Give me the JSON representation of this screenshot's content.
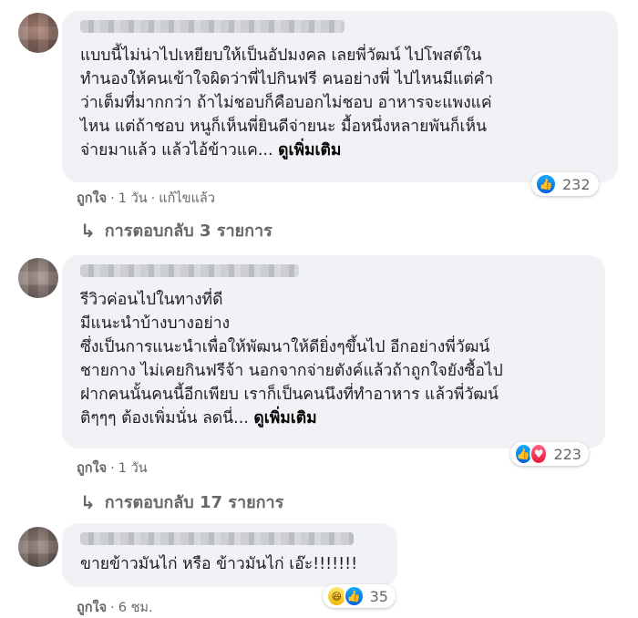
{
  "comments": [
    {
      "text": "แบบนี้ไม่น่าไปเหยียบให้เป็นอัปมงคล เลยพี่วัฒน์ ไปโพสต์ใน\nทำนองให้คนเข้าใจผิดว่าพี่ไปกินฟรี คนอย่างพี่ ไปไหนมีแต่คำ\nว่าเต็มที่มากกว่า ถ้าไม่ชอบก็คือบอกไม่ชอบ อาหารจะแพงแค่\nไหน แต่ถ้าชอบ หนูก็เห็นพี่ยินดีจ่ายนะ มื้อหนึ่งหลายพันก็เห็น\nจ่ายมาแล้ว แล้วไอ้ข้าวแค... ",
      "see_more": "ดูเพิ่มเติม",
      "reaction_count": "232",
      "reactions": [
        "like-icon"
      ],
      "like_label": "ถูกใจ",
      "time": "1 วัน",
      "edited": "แก้ไขแล้ว",
      "replies_label": "การตอบกลับ 3 รายการ"
    },
    {
      "text": "รีวิวค่อนไปในทางที่ดี\nมีแนะนำบ้างบางอย่าง\nซึ่งเป็นการแนะนำเพื่อให้พัฒนาให้ดียิ่งๆขึ้นไป อีกอย่างพี่วัฒน์\nชายกาง ไม่เคยกินฟรีจ้า นอกจากจ่ายตังค์แล้วถ้าถูกใจยังซื้อไป\nฝากคนนั้นคนนี้อีกเพียบ เราก็เป็นคนนึงที่ทำอาหาร แล้วพี่วัฒน์\nติๆๆๆ ต้องเพิ่มนั่น ลดนี่... ",
      "see_more": "ดูเพิ่มเติม",
      "reaction_count": "223",
      "reactions": [
        "like-icon",
        "love-icon"
      ],
      "like_label": "ถูกใจ",
      "time": "1 วัน",
      "replies_label": "การตอบกลับ 17 รายการ"
    },
    {
      "text": "ขายข้าวมันไก่ หรือ ข้าวมันไก่ เอ๊ะ!!!!!!!",
      "reaction_count": "35",
      "reactions": [
        "haha-icon",
        "like-icon"
      ],
      "like_label": "ถูกใจ",
      "time": "6 ชม."
    }
  ],
  "colors": {
    "bubble": "#f0f2f5",
    "meta": "#65676b",
    "like": "#1877f2",
    "love": "#f33e58"
  }
}
